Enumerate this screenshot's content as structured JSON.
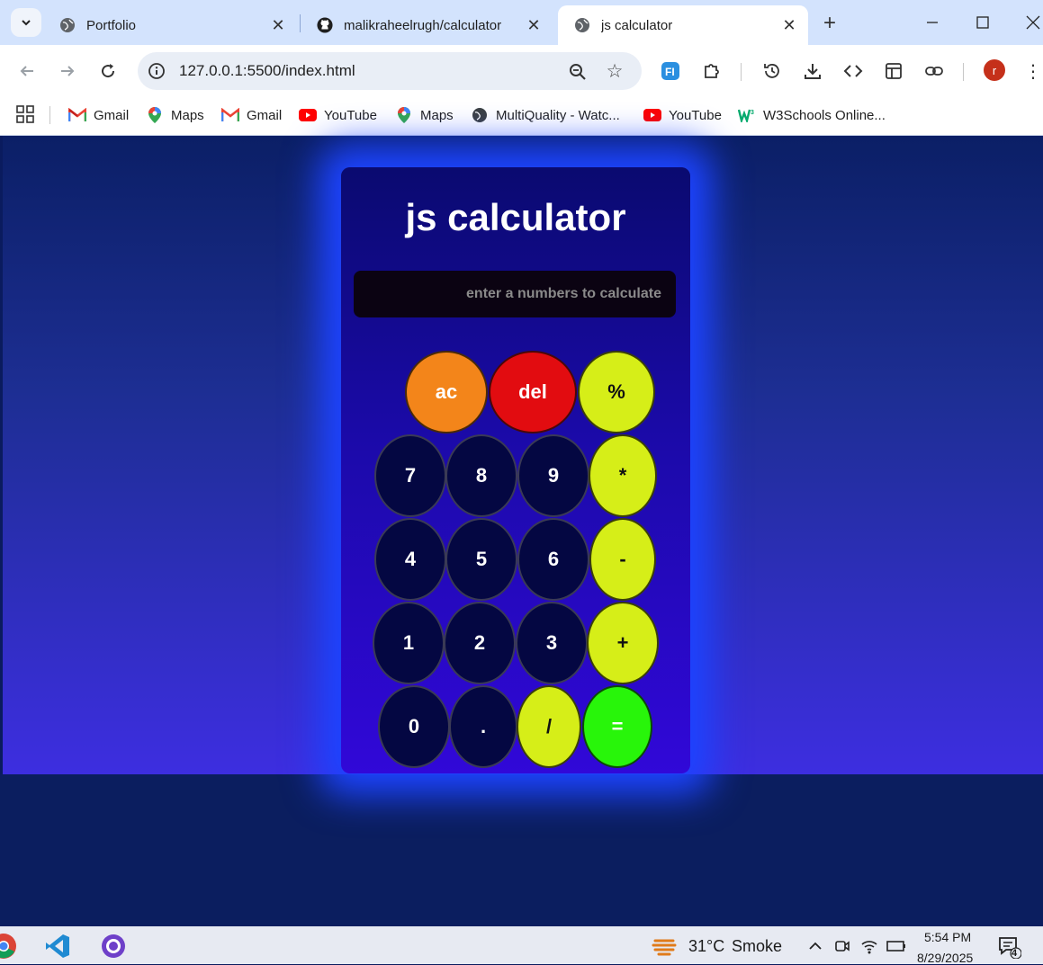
{
  "browser": {
    "tabs": [
      {
        "title": "Portfolio",
        "active": false
      },
      {
        "title": "malikraheelrugh/calculator",
        "active": false
      },
      {
        "title": "js calculator",
        "active": true
      }
    ],
    "url": "127.0.0.1:5500/index.html",
    "profile_initial": "r",
    "bookmarks": [
      "Gmail",
      "Maps",
      "Gmail",
      "YouTube",
      "Maps",
      "MultiQuality - Watc...",
      "YouTube",
      "W3Schools Online..."
    ]
  },
  "calculator": {
    "title": "js calculator",
    "display_placeholder": "enter a numbers to calculate",
    "keys": {
      "ac": "ac",
      "del": "del",
      "percent": "%",
      "seven": "7",
      "eight": "8",
      "nine": "9",
      "multiply": "*",
      "four": "4",
      "five": "5",
      "six": "6",
      "minus": "-",
      "one": "1",
      "two": "2",
      "three": "3",
      "plus": "+",
      "zero": "0",
      "dot": ".",
      "divide": "/",
      "equals": "="
    }
  },
  "taskbar": {
    "temperature": "31°C",
    "weather": "Smoke",
    "time": "5:54 PM",
    "date": "8/29/2025",
    "notification_count": "4"
  },
  "colors": {
    "accent_operator": "#d6ee18",
    "ac": "#f3851a",
    "del": "#e20c10",
    "equals": "#28f50a",
    "number_key": "#040742"
  }
}
